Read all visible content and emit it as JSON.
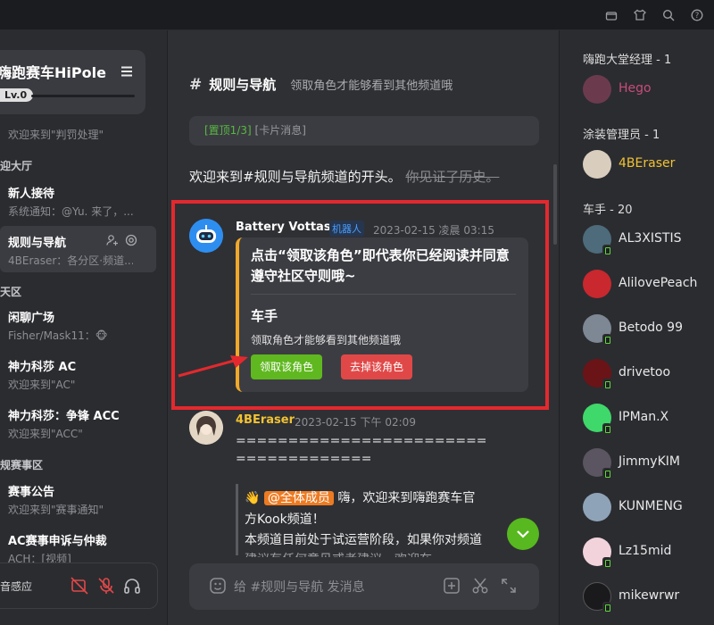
{
  "server": {
    "name": "嗨跑赛车HiPole",
    "level": "Lv.0"
  },
  "sidebar": {
    "top_channel": "欢迎来到\"判罚处理\"",
    "categories": [
      "迎大厅",
      "天区",
      "规赛事区"
    ],
    "channels": [
      {
        "title": "新人接待",
        "sub": "系统通知：@Yu. 来了，..."
      },
      {
        "title": "规则与导航",
        "sub": "4BEraser：各分区·频道..."
      },
      {
        "title": "闲聊广场",
        "sub": "Fisher/Mask11：🐵"
      },
      {
        "title": "神力科莎 AC",
        "sub": "欢迎来到\"AC\""
      },
      {
        "title": "神力科莎：争锋 ACC",
        "sub": "欢迎来到\"ACC\""
      },
      {
        "title": "赛事公告",
        "sub": "欢迎来到\"赛事通知\""
      },
      {
        "title": "AC赛事申诉与仲裁",
        "sub": "ACH：[视频]"
      }
    ],
    "voice_label": "音感应"
  },
  "header": {
    "title": "规则与导航",
    "desc": "领取角色才能够看到其他频道哦"
  },
  "pinned": {
    "tag": "[置顶1/3]",
    "text": "[卡片消息]"
  },
  "intro": {
    "main": "欢迎来到#规则与导航频道的开头。",
    "strike": "你见证了历史。"
  },
  "bot_message": {
    "author": "Battery Vottas",
    "tag": "机器人",
    "time": "2023-02-15 凌晨 03:15",
    "card_title": "点击“领取该角色”即代表你已经阅读并同意遵守社区守则哦~",
    "card_sub": "车手",
    "card_desc": "领取角色才能够看到其他频道哦",
    "btn_claim": "领取该角色",
    "btn_remove": "去掉该角色"
  },
  "user_message": {
    "author": "4BEraser",
    "time": "2023-02-15 下午 02:09",
    "line1": "========================",
    "line2": "=============",
    "q_wave": "👋",
    "q_mention": "@全体成员",
    "q_line1": "嗨，欢迎来到嗨跑赛车官",
    "q_line2": "方Kook频道！",
    "q_line3": "本频道目前处于试运营阶段，如果你对频道",
    "q_line4": "建议有任何意见或者建议，欢迎在"
  },
  "input": {
    "placeholder": "给 #规则与导航 发消息"
  },
  "members": {
    "groups": [
      {
        "title": "嗨跑大堂经理 - 1"
      },
      {
        "title": "涂装管理员 - 1"
      },
      {
        "title": "车手 - 20"
      }
    ],
    "list": [
      {
        "name": "Hego",
        "color": "#c94c78"
      },
      {
        "name": "4BEraser",
        "color": "#f1c232"
      },
      {
        "name": "AL3XISTIS",
        "color": "#e8e8e8"
      },
      {
        "name": "AlilovePeach",
        "color": "#e8e8e8"
      },
      {
        "name": "Betodo 99",
        "color": "#e8e8e8"
      },
      {
        "name": "drivetoo",
        "color": "#e8e8e8"
      },
      {
        "name": "IPMan.X",
        "color": "#e8e8e8"
      },
      {
        "name": "JimmyKIM",
        "color": "#e8e8e8"
      },
      {
        "name": "KUNMENG",
        "color": "#e8e8e8"
      },
      {
        "name": "Lz15mid",
        "color": "#e8e8e8"
      },
      {
        "name": "mikewrwr",
        "color": "#e8e8e8"
      }
    ]
  },
  "colors": {
    "accent_green": "#5fb81f",
    "danger_red": "#e04848",
    "highlight_box": "#e3292e",
    "card_border": "#f0a92a"
  }
}
